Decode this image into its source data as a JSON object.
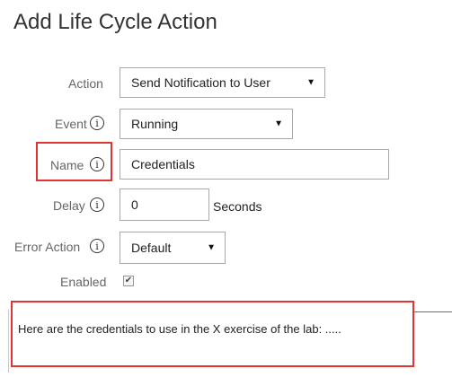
{
  "dialog": {
    "title": "Add Life Cycle Action"
  },
  "form": {
    "action": {
      "label": "Action",
      "value": "Send Notification to User"
    },
    "event": {
      "label": "Event",
      "value": "Running"
    },
    "name": {
      "label": "Name",
      "value": "Credentials"
    },
    "delay": {
      "label": "Delay",
      "value": "0",
      "unit": "Seconds"
    },
    "error_action": {
      "label": "Error Action",
      "value": "Default"
    },
    "enabled": {
      "label": "Enabled",
      "checked": true
    }
  },
  "message": {
    "text": "Here are the credentials to use in the X exercise of the lab: ....."
  },
  "colors": {
    "highlight": "#e03535",
    "accent_line": "#2f7dd1"
  }
}
